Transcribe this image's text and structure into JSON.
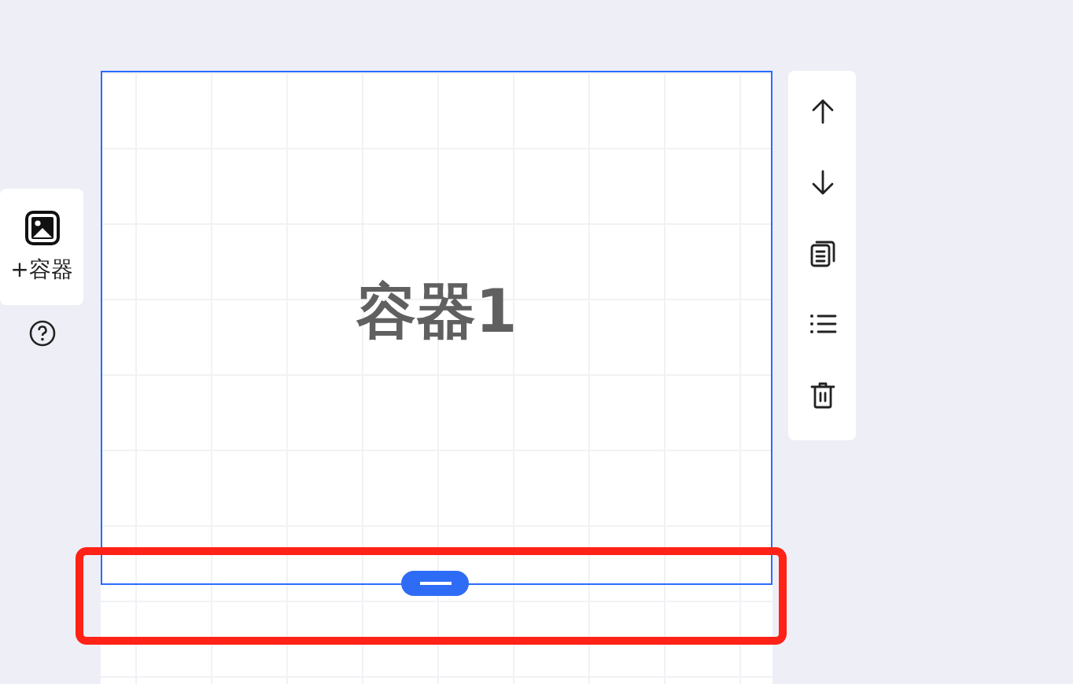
{
  "left_panel": {
    "add_button": {
      "label": "+容器"
    }
  },
  "canvas": {
    "container": {
      "label": "容器1",
      "selected": true
    }
  }
}
